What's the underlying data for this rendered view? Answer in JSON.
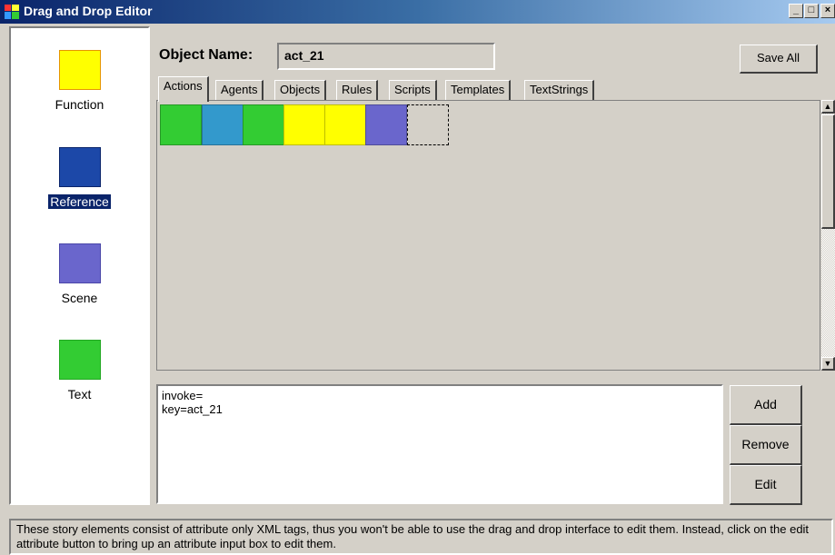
{
  "window": {
    "title": "Drag and Drop Editor",
    "controls": {
      "minimize": "_",
      "maximize": "□",
      "close": "×"
    }
  },
  "palette": {
    "items": [
      {
        "label": "Function",
        "color": "#ffff00",
        "border": "#e69500",
        "icon": "function-swatch-icon",
        "selected": false
      },
      {
        "label": "Reference",
        "color": "#1c48a8",
        "border": "#0a246a",
        "icon": "reference-swatch-icon",
        "selected": true
      },
      {
        "label": "Scene",
        "color": "#6a66cc",
        "border": "#4a46a8",
        "icon": "scene-swatch-icon",
        "selected": false
      },
      {
        "label": "Text",
        "color": "#33cc33",
        "border": "#22a822",
        "icon": "text-swatch-icon",
        "selected": false
      }
    ]
  },
  "object": {
    "name_label": "Object Name:",
    "name_value": "act_21"
  },
  "toolbar": {
    "save_all_label": "Save All"
  },
  "tabs": [
    {
      "label": "Actions",
      "active": true
    },
    {
      "label": "Agents",
      "active": false
    },
    {
      "label": "Objects",
      "active": false
    },
    {
      "label": "Rules",
      "active": false
    },
    {
      "label": "Scripts",
      "active": false
    },
    {
      "label": "Templates",
      "active": false
    },
    {
      "label": "TextStrings",
      "active": false
    }
  ],
  "workspace": {
    "blocks": [
      {
        "type": "Text",
        "color": "#33cc33"
      },
      {
        "type": "Reference",
        "color": "#3399cc"
      },
      {
        "type": "Text",
        "color": "#33cc33"
      },
      {
        "type": "Function",
        "color": "#ffff00"
      },
      {
        "type": "Function",
        "color": "#ffff00"
      },
      {
        "type": "Scene",
        "color": "#6a66cc"
      },
      {
        "type": "empty-slot",
        "color": "transparent"
      }
    ]
  },
  "attributes": {
    "text": "invoke=\nkey=act_21"
  },
  "attribute_buttons": {
    "add_label": "Add",
    "remove_label": "Remove",
    "edit_label": "Edit"
  },
  "status": {
    "message": "These story elements consist of attribute only XML tags, thus you won't be able to use the drag and drop interface to edit them. Instead, click on the edit attribute button to bring up an attribute input box to edit them."
  },
  "scrollbar": {
    "up_arrow": "▲",
    "down_arrow": "▼"
  }
}
